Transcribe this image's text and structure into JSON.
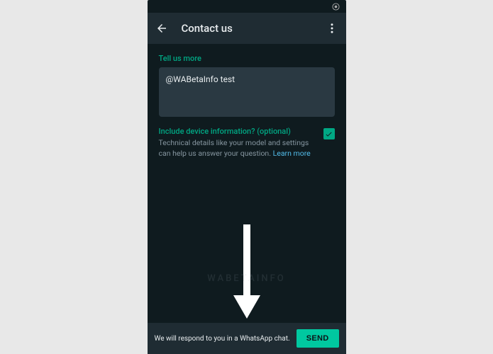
{
  "header": {
    "title": "Contact us"
  },
  "form": {
    "tell_us_label": "Tell us more",
    "input_value": "@WABetaInfo test",
    "device_info_title": "Include device information? (optional)",
    "device_info_desc": "Technical details like your model and settings can help us answer your question. ",
    "learn_more": "Learn more",
    "checkbox_checked": true
  },
  "footer": {
    "respond_text": "We will respond to you in a WhatsApp chat.",
    "send_label": "SEND"
  },
  "watermark": "WABETAINFO"
}
